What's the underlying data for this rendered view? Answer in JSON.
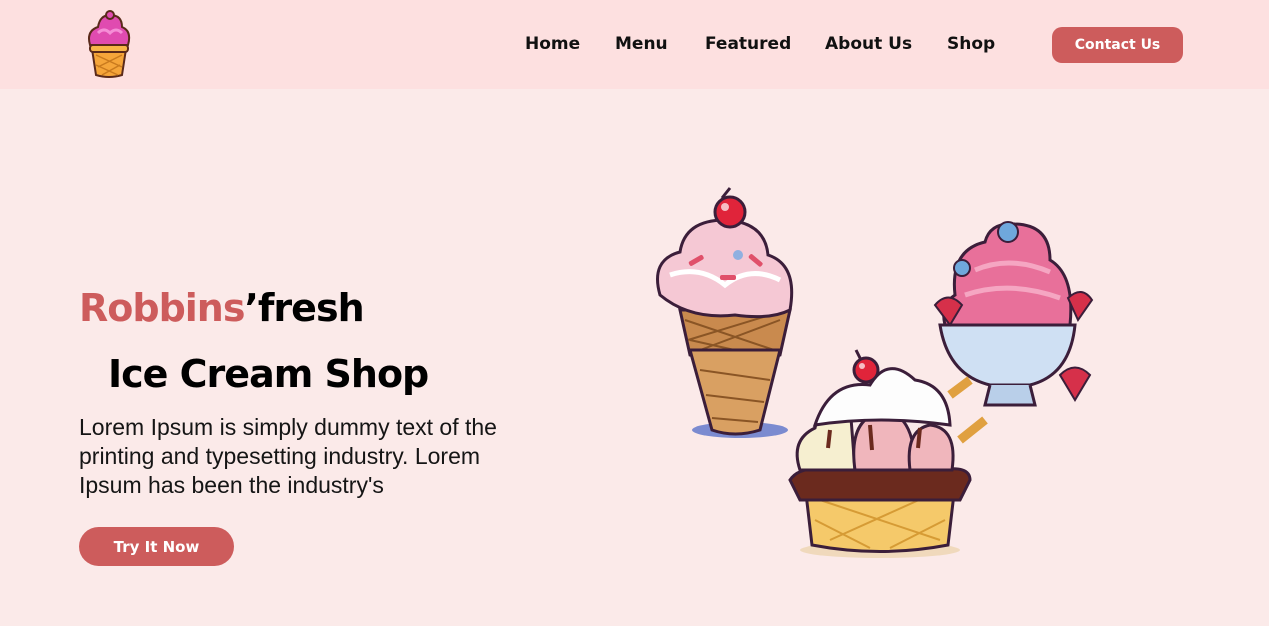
{
  "nav": {
    "items": [
      {
        "label": "Home"
      },
      {
        "label": "Menu"
      },
      {
        "label": "Featured"
      },
      {
        "label": "About Us"
      },
      {
        "label": "Shop"
      }
    ],
    "contact_label": "Contact Us"
  },
  "hero": {
    "brand_part1": "Robbins",
    "brand_part2": "’fresh",
    "subtitle": "Ice Cream Shop",
    "description": "Lorem Ipsum is simply dummy text of the printing and typesetting industry. Lorem Ipsum has been the industry's",
    "cta_label": "Try It Now"
  },
  "colors": {
    "accent": "#cd5c5c",
    "nav_bg": "#fde0e0",
    "page_bg": "#fbeae9"
  },
  "icons": {
    "logo": "ice-cream-cone-logo-icon",
    "illustration": "ice-cream-illustration"
  }
}
